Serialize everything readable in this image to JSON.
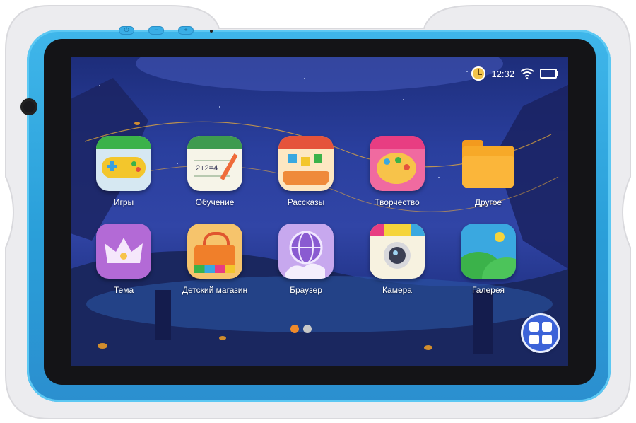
{
  "status_bar": {
    "time": "12:32",
    "icons": [
      "clock-icon",
      "wifi-icon",
      "battery-icon"
    ]
  },
  "home_screen": {
    "apps": [
      {
        "label": "Игры",
        "icon": "gamepad-icon",
        "color": "#3bb24a"
      },
      {
        "label": "Обучение",
        "icon": "notebook-icon",
        "color": "#3e9b4f"
      },
      {
        "label": "Рассказы",
        "icon": "storybook-icon",
        "color": "#e5533b"
      },
      {
        "label": "Творчество",
        "icon": "palette-icon",
        "color": "#e83d82"
      },
      {
        "label": "Другое",
        "icon": "folder-icon",
        "color": "#f39a1e"
      },
      {
        "label": "Тема",
        "icon": "crown-icon",
        "color": "#b36ad6"
      },
      {
        "label": "Детский магазин",
        "icon": "shopping-bag-icon",
        "color": "#f07f2a"
      },
      {
        "label": "Браузер",
        "icon": "globe-icon",
        "color": "#8a5bd1"
      },
      {
        "label": "Камера",
        "icon": "camera-icon",
        "color": "#f5d43b"
      },
      {
        "label": "Галерея",
        "icon": "gallery-icon",
        "color": "#3aa8e0"
      }
    ],
    "pager": {
      "pages": 2,
      "active_page": 1,
      "colors": [
        "#f08a2a",
        "#c8c8c8"
      ]
    },
    "all_apps_button": {
      "icon": "app-grid-icon"
    }
  },
  "device": {
    "hardware_buttons": [
      "power-icon",
      "volume-down-icon",
      "volume-up-icon"
    ],
    "bumper_color": "#33a8e3"
  }
}
